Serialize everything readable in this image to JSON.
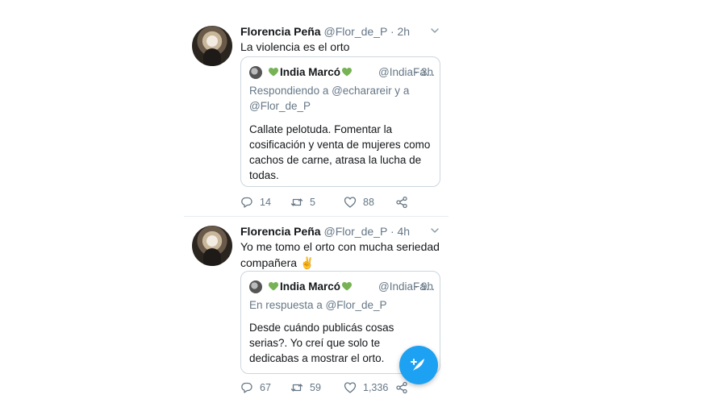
{
  "tweets": [
    {
      "author_name": "Florencia Peña",
      "author_handle": "@Flor_de_P",
      "separator": "·",
      "time": "2h",
      "text": "La violencia es el orto",
      "text_emoji": "",
      "quote": {
        "author_name": "India Marcó",
        "author_handle": "@IndiaFa...",
        "separator": "·",
        "time": "3h",
        "reply_context": "Respondiendo a @echarareir y a @Flor_de_P",
        "text": "Callate pelotuda. Fomentar la cosificación y venta de mujeres como cachos de carne, atrasa la lucha de todas."
      },
      "stats": {
        "replies": "14",
        "retweets": "5",
        "likes": "88"
      }
    },
    {
      "author_name": "Florencia Peña",
      "author_handle": "@Flor_de_P",
      "separator": "·",
      "time": "4h",
      "text": "Yo me tomo el orto con mucha seriedad compañera",
      "text_emoji": "✌",
      "quote": {
        "author_name": "India Marcó",
        "author_handle": "@IndiaFa...",
        "separator": "·",
        "time": "9h",
        "reply_context": "En respuesta a @Flor_de_P",
        "text": "Desde cuándo publicás cosas serias?. Yo creí que solo te dedicabas a mostrar el orto."
      },
      "stats": {
        "replies": "67",
        "retweets": "59",
        "likes": "1,336"
      }
    }
  ],
  "icons": {
    "reply": "reply-icon",
    "retweet": "retweet-icon",
    "like": "like-icon",
    "share": "share-icon",
    "chevron": "chevron-down-icon",
    "heart_emoji": "green-heart-emoji-icon",
    "compose": "compose-tweet-icon"
  },
  "colors": {
    "accent": "#1da1f2",
    "secondary_text": "#657786",
    "green_heart": "#77b255"
  }
}
